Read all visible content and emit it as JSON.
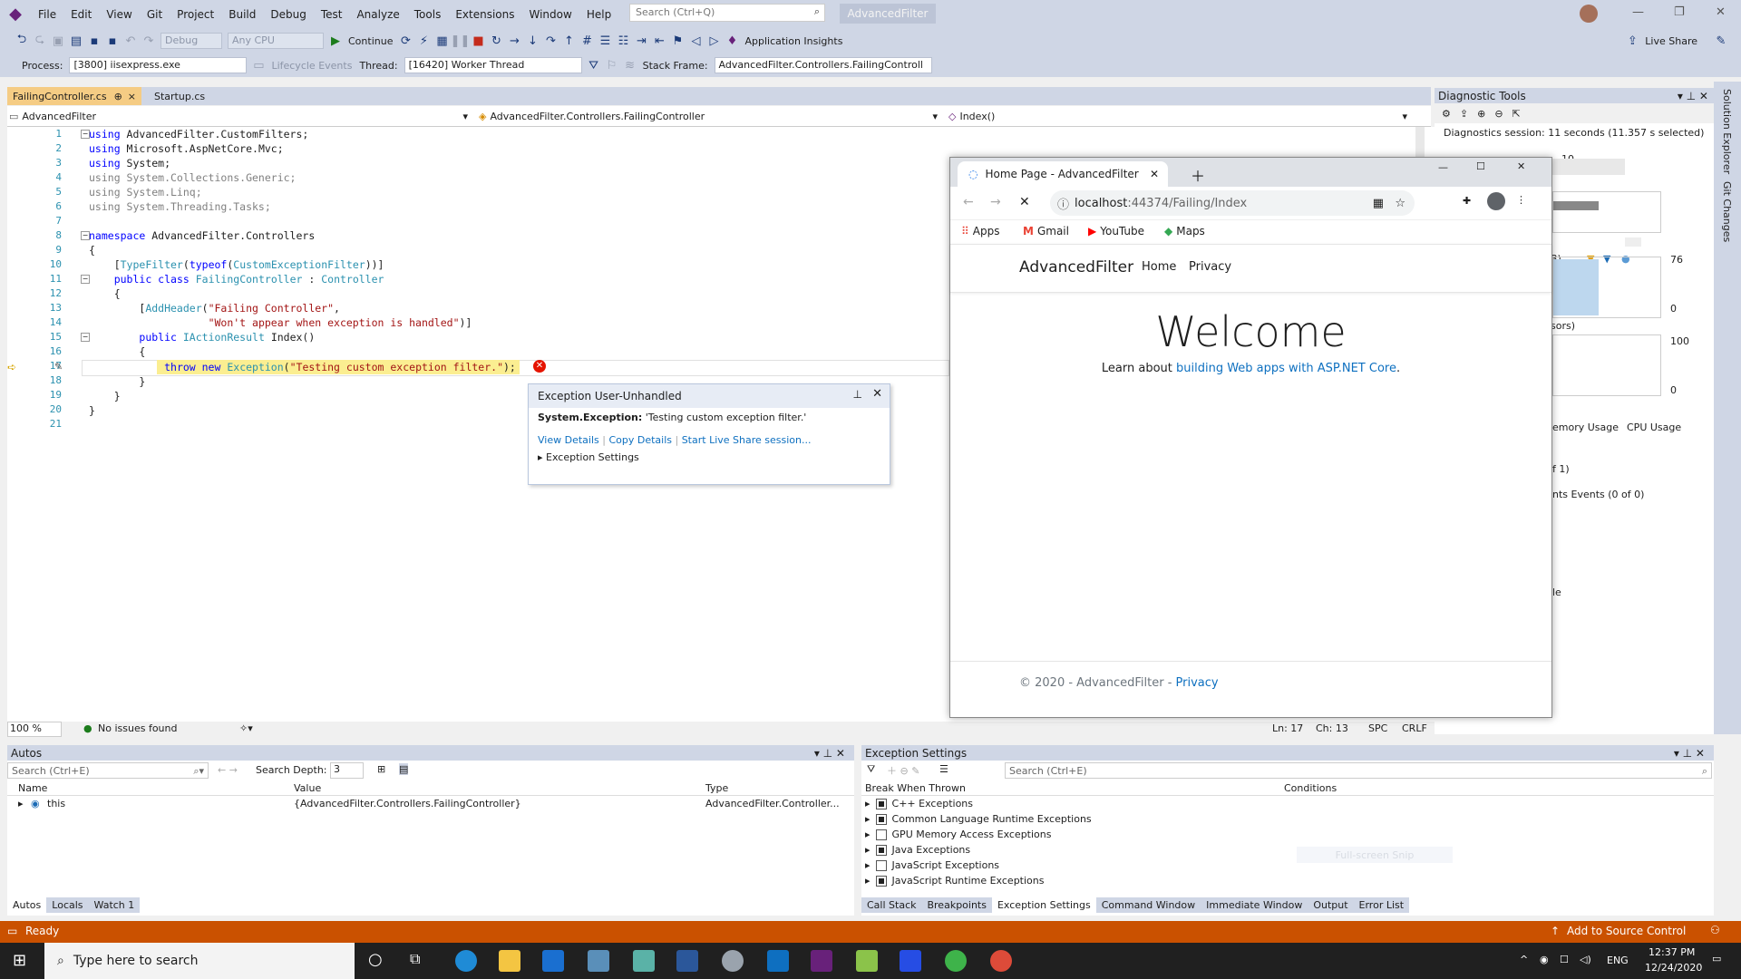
{
  "menu": {
    "items": [
      "File",
      "Edit",
      "View",
      "Git",
      "Project",
      "Build",
      "Debug",
      "Test",
      "Analyze",
      "Tools",
      "Extensions",
      "Window",
      "Help"
    ],
    "search_placeholder": "Search (Ctrl+Q)",
    "solution_name": "AdvancedFilter"
  },
  "toolbar1": {
    "config": "Debug",
    "platform": "Any CPU",
    "continue_label": "Continue",
    "app_insights_label": "Application Insights",
    "live_share_label": "Live Share"
  },
  "toolbar2": {
    "process_label": "Process:",
    "process_value": "[3800] iisexpress.exe",
    "lifecycle_label": "Lifecycle Events",
    "thread_label": "Thread:",
    "thread_value": "[16420] Worker Thread",
    "stack_frame_label": "Stack Frame:",
    "stack_frame_value": "AdvancedFilter.Controllers.FailingControll"
  },
  "tabs": [
    {
      "label": "FailingController.cs",
      "pin": "⊕",
      "close": "×"
    },
    {
      "label": "Startup.cs"
    }
  ],
  "nav": {
    "project": "AdvancedFilter",
    "class": "AdvancedFilter.Controllers.FailingController",
    "member": "Index()"
  },
  "code": {
    "line_numbers": [
      "1",
      "2",
      "3",
      "4",
      "5",
      "6",
      "7",
      "8",
      "9",
      "10",
      "11",
      "12",
      "13",
      "14",
      "15",
      "16",
      "17",
      "18",
      "19",
      "20",
      "21"
    ]
  },
  "exception": {
    "title": "Exception User-Unhandled",
    "type": "System.Exception:",
    "message": "'Testing custom exception filter.'",
    "view_details": "View Details",
    "copy_details": "Copy Details",
    "live_share": "Start Live Share session...",
    "settings": "Exception Settings"
  },
  "editor_status": {
    "zoom": "100 %",
    "issues": "No issues found",
    "ln": "Ln: 17",
    "ch": "Ch: 13",
    "spc": "SPC",
    "crlf": "CRLF"
  },
  "autos": {
    "title": "Autos",
    "search_placeholder": "Search (Ctrl+E)",
    "depth_label": "Search Depth:",
    "depth_value": "3",
    "columns": [
      "Name",
      "Value",
      "Type"
    ],
    "rows": [
      {
        "name": "this",
        "value": "{AdvancedFilter.Controllers.FailingController}",
        "type": "AdvancedFilter.Controller..."
      }
    ],
    "tabs": [
      "Autos",
      "Locals",
      "Watch 1"
    ]
  },
  "exc_settings": {
    "title": "Exception Settings",
    "search_placeholder": "Search (Ctrl+E)",
    "columns": [
      "Break When Thrown",
      "Conditions"
    ],
    "items": [
      {
        "label": "C++ Exceptions",
        "checked": "full"
      },
      {
        "label": "Common Language Runtime Exceptions",
        "checked": "full"
      },
      {
        "label": "GPU Memory Access Exceptions",
        "checked": "none"
      },
      {
        "label": "Java Exceptions",
        "checked": "full"
      },
      {
        "label": "JavaScript Exceptions",
        "checked": "none"
      },
      {
        "label": "JavaScript Runtime Exceptions",
        "checked": "full"
      }
    ],
    "overlay": "Full-screen Snip",
    "tabs": [
      "Call Stack",
      "Breakpoints",
      "Exception Settings",
      "Command Window",
      "Immediate Window",
      "Output",
      "Error List"
    ]
  },
  "diag": {
    "title": "Diagnostic Tools",
    "session": "Diagnostics session: 11 seconds (11.357 s selected)",
    "tick": "10",
    "frag_b": "B)",
    "val_76": "76",
    "val_0a": "0",
    "frag_sors": "sors)",
    "val_100": "100",
    "val_0b": "0",
    "tab_memory": "emory Usage",
    "tab_cpu": "CPU Usage",
    "frag_of1": "f 1)",
    "frag_events": "nts Events (0 of 0)",
    "frag_le": "le"
  },
  "rail": {
    "solution_explorer": "Solution Explorer",
    "git_changes": "Git Changes"
  },
  "status": {
    "ready": "Ready",
    "source_control": "Add to Source Control"
  },
  "taskbar": {
    "search": "Type here to search",
    "lang": "ENG",
    "time": "12:37 PM",
    "date": "12/24/2020"
  },
  "browser": {
    "tab_title": "Home Page - AdvancedFilter",
    "url_host": "localhost",
    "url_rest": ":44374/Failing/Index",
    "bookmarks": [
      "Apps",
      "Gmail",
      "YouTube",
      "Maps"
    ],
    "brand": "AdvancedFilter",
    "nav": [
      "Home",
      "Privacy"
    ],
    "heading": "Welcome",
    "learn_prefix": "Learn about ",
    "learn_link": "building Web apps with ASP.NET Core",
    "learn_suffix": ".",
    "footer_text": "© 2020 - AdvancedFilter - ",
    "footer_link": "Privacy"
  },
  "colors": {
    "accent": "#68217a",
    "statusbar": "#ca5100",
    "tab_active": "#f5cc84",
    "highlight": "#fbee91"
  }
}
